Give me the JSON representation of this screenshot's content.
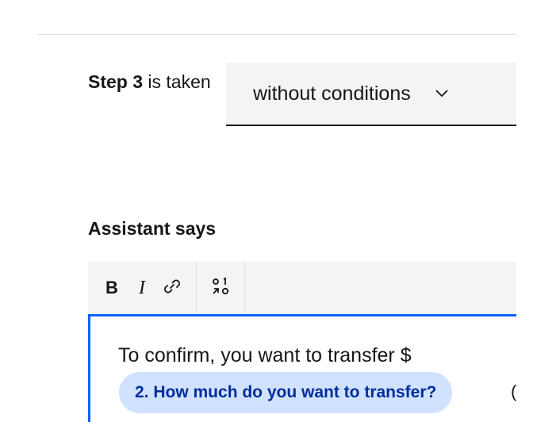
{
  "step": {
    "label_strong": "Step 3",
    "label_rest": " is taken"
  },
  "condition_select": {
    "value": "without conditions",
    "chevron_icon": "chevron-down-icon"
  },
  "assistant": {
    "heading": "Assistant says",
    "toolbar": {
      "bold_label": "B",
      "italic_label": "I",
      "link_icon": "link-icon",
      "variable_icon": "variable-icon"
    },
    "editor": {
      "text": "To confirm, you want to transfer $",
      "variable_chip": "2. How much do you want to transfer?",
      "trailing_fragment": "("
    },
    "accent_color": "#0f62fe",
    "chip_background": "#d0e2ff",
    "chip_text_color": "#002d9c"
  }
}
